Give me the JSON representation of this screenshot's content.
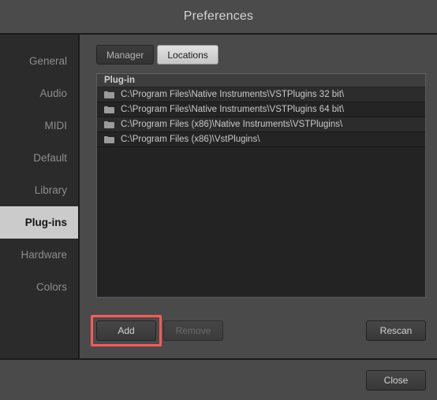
{
  "window": {
    "title": "Preferences"
  },
  "sidebar": {
    "items": [
      {
        "label": "General",
        "active": false
      },
      {
        "label": "Audio",
        "active": false
      },
      {
        "label": "MIDI",
        "active": false
      },
      {
        "label": "Default",
        "active": false
      },
      {
        "label": "Library",
        "active": false
      },
      {
        "label": "Plug-ins",
        "active": true
      },
      {
        "label": "Hardware",
        "active": false
      },
      {
        "label": "Colors",
        "active": false
      }
    ]
  },
  "tabs": [
    {
      "label": "Manager",
      "active": false
    },
    {
      "label": "Locations",
      "active": true
    }
  ],
  "list": {
    "header": "Plug-in",
    "rows": [
      {
        "icon": "folder-icon",
        "path": "C:\\Program Files\\Native Instruments\\VSTPlugins 32 bit\\"
      },
      {
        "icon": "folder-icon",
        "path": "C:\\Program Files\\Native Instruments\\VSTPlugins 64 bit\\"
      },
      {
        "icon": "folder-icon",
        "path": "C:\\Program Files (x86)\\Native Instruments\\VSTPlugins\\"
      },
      {
        "icon": "folder-icon",
        "path": "C:\\Program Files (x86)\\VstPlugins\\"
      }
    ]
  },
  "actions": {
    "add": "Add",
    "remove": "Remove",
    "rescan": "Rescan"
  },
  "footer": {
    "close": "Close"
  },
  "colors": {
    "highlight": "#ff5a5a",
    "window_bg": "#4a4a4a",
    "sidebar_bg": "#2b2b2b",
    "list_bg": "#232323",
    "active_item_bg": "#cbcbcb"
  }
}
